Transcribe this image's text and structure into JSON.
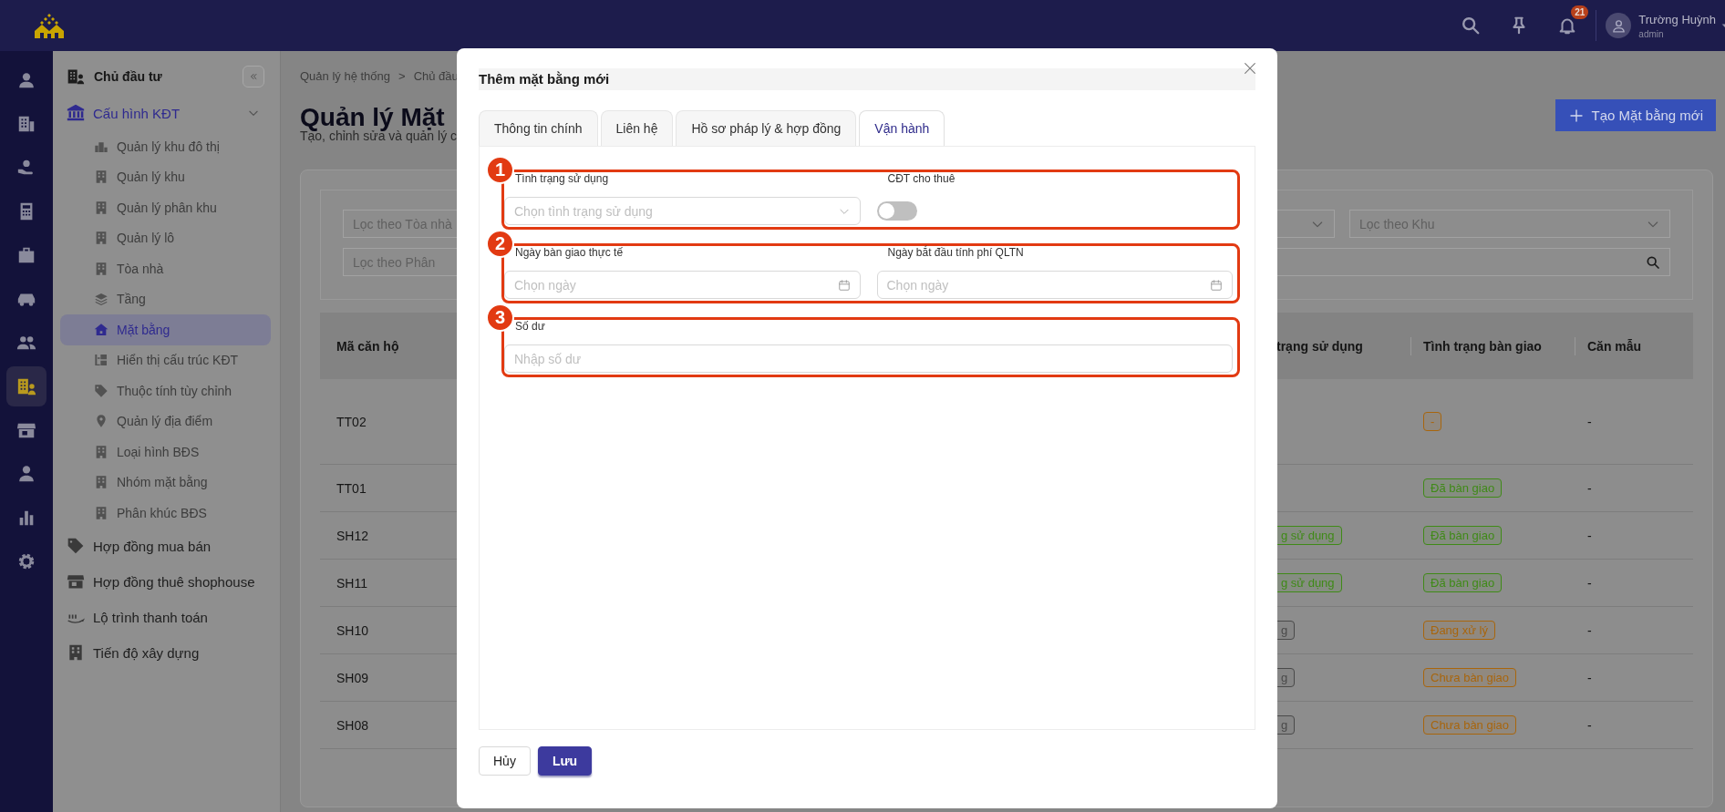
{
  "top_bar": {
    "notifications": "21",
    "user": {
      "name": "Trường Huỳnh",
      "role": "admin"
    }
  },
  "icon_rail": [
    {
      "selected": false
    },
    {
      "selected": false
    },
    {
      "selected": false
    },
    {
      "selected": false
    },
    {
      "selected": false
    },
    {
      "selected": false
    },
    {
      "selected": false
    },
    {
      "selected": true
    },
    {
      "selected": false
    },
    {
      "selected": false
    },
    {
      "selected": false
    },
    {
      "selected": false
    }
  ],
  "sidebar": {
    "heading": "Chủ đầu tư",
    "items": [
      {
        "label": "Cấu hình KĐT",
        "selected": false,
        "expanded": true,
        "children": [
          {
            "label": "Quản lý khu đô thị",
            "selected": false
          },
          {
            "label": "Quản lý khu",
            "selected": false
          },
          {
            "label": "Quản lý phân khu",
            "selected": false
          },
          {
            "label": "Quản lý lô",
            "selected": false
          },
          {
            "label": "Tòa nhà",
            "selected": false
          },
          {
            "label": "Tầng",
            "selected": false
          },
          {
            "label": "Mặt bằng",
            "selected": true
          },
          {
            "label": "Hiển thị cấu trúc KĐT",
            "selected": false
          },
          {
            "label": "Thuộc tính tùy chỉnh",
            "selected": false
          },
          {
            "label": "Quản lý địa điểm",
            "selected": false
          },
          {
            "label": "Loại hình BĐS",
            "selected": false
          },
          {
            "label": "Nhóm mặt bằng",
            "selected": false
          },
          {
            "label": "Phân khúc BĐS",
            "selected": false
          }
        ]
      },
      {
        "label": "Hợp đồng mua bán",
        "selected": false
      },
      {
        "label": "Hợp đồng thuê shophouse",
        "selected": false
      },
      {
        "label": "Lộ trình thanh toán",
        "selected": false
      },
      {
        "label": "Tiến độ xây dựng",
        "selected": false
      }
    ]
  },
  "breadcrumb": {
    "items": [
      "Quản lý hệ thống",
      "Chủ đầu"
    ],
    "separator": ">"
  },
  "page": {
    "title": "Quản lý Mặt",
    "subtitle": "Tạo, chỉnh sửa và quản lý c",
    "create_button": "Tạo Mặt bằng mới"
  },
  "filters": [
    [
      {
        "kind": "input",
        "placeholder": "Lọc theo Tòa nhà"
      },
      {
        "kind": "select"
      },
      {
        "kind": "select",
        "placeholder": "Lọc theo Khu"
      }
    ],
    [
      {
        "kind": "input",
        "placeholder": "Lọc theo Phân"
      },
      {
        "kind": "search"
      }
    ]
  ],
  "table": {
    "columns": [
      "Mã căn hộ",
      "trạng sử dụng",
      "Tình trạng bàn giao",
      "Căn mẫu"
    ],
    "rows": [
      {
        "code": "TT02",
        "handover": {
          "text": "-",
          "color": "#a8650c"
        },
        "sample": "-"
      },
      {
        "code": "TT01",
        "handover": {
          "text": "Đã bàn giao",
          "color": "#3f8a17"
        },
        "sample": "-"
      },
      {
        "code": "SH12",
        "usage": {
          "text": "g sử dụng",
          "color": "#3f8a17"
        },
        "handover": {
          "text": "Đã bàn giao",
          "color": "#3f8a17"
        },
        "sample": "-"
      },
      {
        "code": "SH11",
        "usage": {
          "text": "g sử dụng",
          "color": "#3f8a17"
        },
        "handover": {
          "text": "Đã bàn giao",
          "color": "#3f8a17"
        },
        "sample": "-"
      },
      {
        "code": "SH10",
        "usage": {
          "text": "g",
          "color": "#4a4a4a"
        },
        "handover": {
          "text": "Đang xử lý",
          "color": "#a8650c"
        },
        "sample": "-"
      },
      {
        "code": "SH09",
        "usage": {
          "text": "g",
          "color": "#4a4a4a"
        },
        "handover": {
          "text": "Chưa bàn giao",
          "color": "#a8650c"
        },
        "sample": "-"
      },
      {
        "code": "SH08",
        "usage": {
          "text": "g",
          "color": "#4a4a4a"
        },
        "handover": {
          "text": "Chưa bàn giao",
          "color": "#a8650c"
        },
        "sample": "-"
      }
    ]
  },
  "modal": {
    "title": "Thêm mặt bằng mới",
    "tabs": [
      {
        "label": "Thông tin chính",
        "selected": false
      },
      {
        "label": "Liên hệ",
        "selected": false
      },
      {
        "label": "Hồ sơ pháp lý & hợp đồng",
        "selected": false
      },
      {
        "label": "Vận hành",
        "selected": true
      }
    ],
    "sections": [
      {
        "marker": "1",
        "fields": [
          {
            "kind": "select",
            "label": "Tình trạng sử dụng",
            "placeholder": "Chọn tình trạng sử dụng"
          },
          {
            "kind": "toggle",
            "label": "CĐT cho thuê",
            "on": false
          }
        ]
      },
      {
        "marker": "2",
        "fields": [
          {
            "kind": "date",
            "label": "Ngày bàn giao thực tế",
            "placeholder": "Chọn ngày"
          },
          {
            "kind": "date",
            "label": "Ngày bắt đầu tính phí QLTN",
            "placeholder": "Chọn ngày"
          }
        ]
      },
      {
        "marker": "3",
        "fields": [
          {
            "kind": "text",
            "label": "Số dư",
            "placeholder": "Nhập số dư"
          }
        ]
      }
    ],
    "buttons": [
      {
        "label": "Hủy",
        "kind": "secondary"
      },
      {
        "label": "Lưu",
        "kind": "primary"
      }
    ]
  }
}
